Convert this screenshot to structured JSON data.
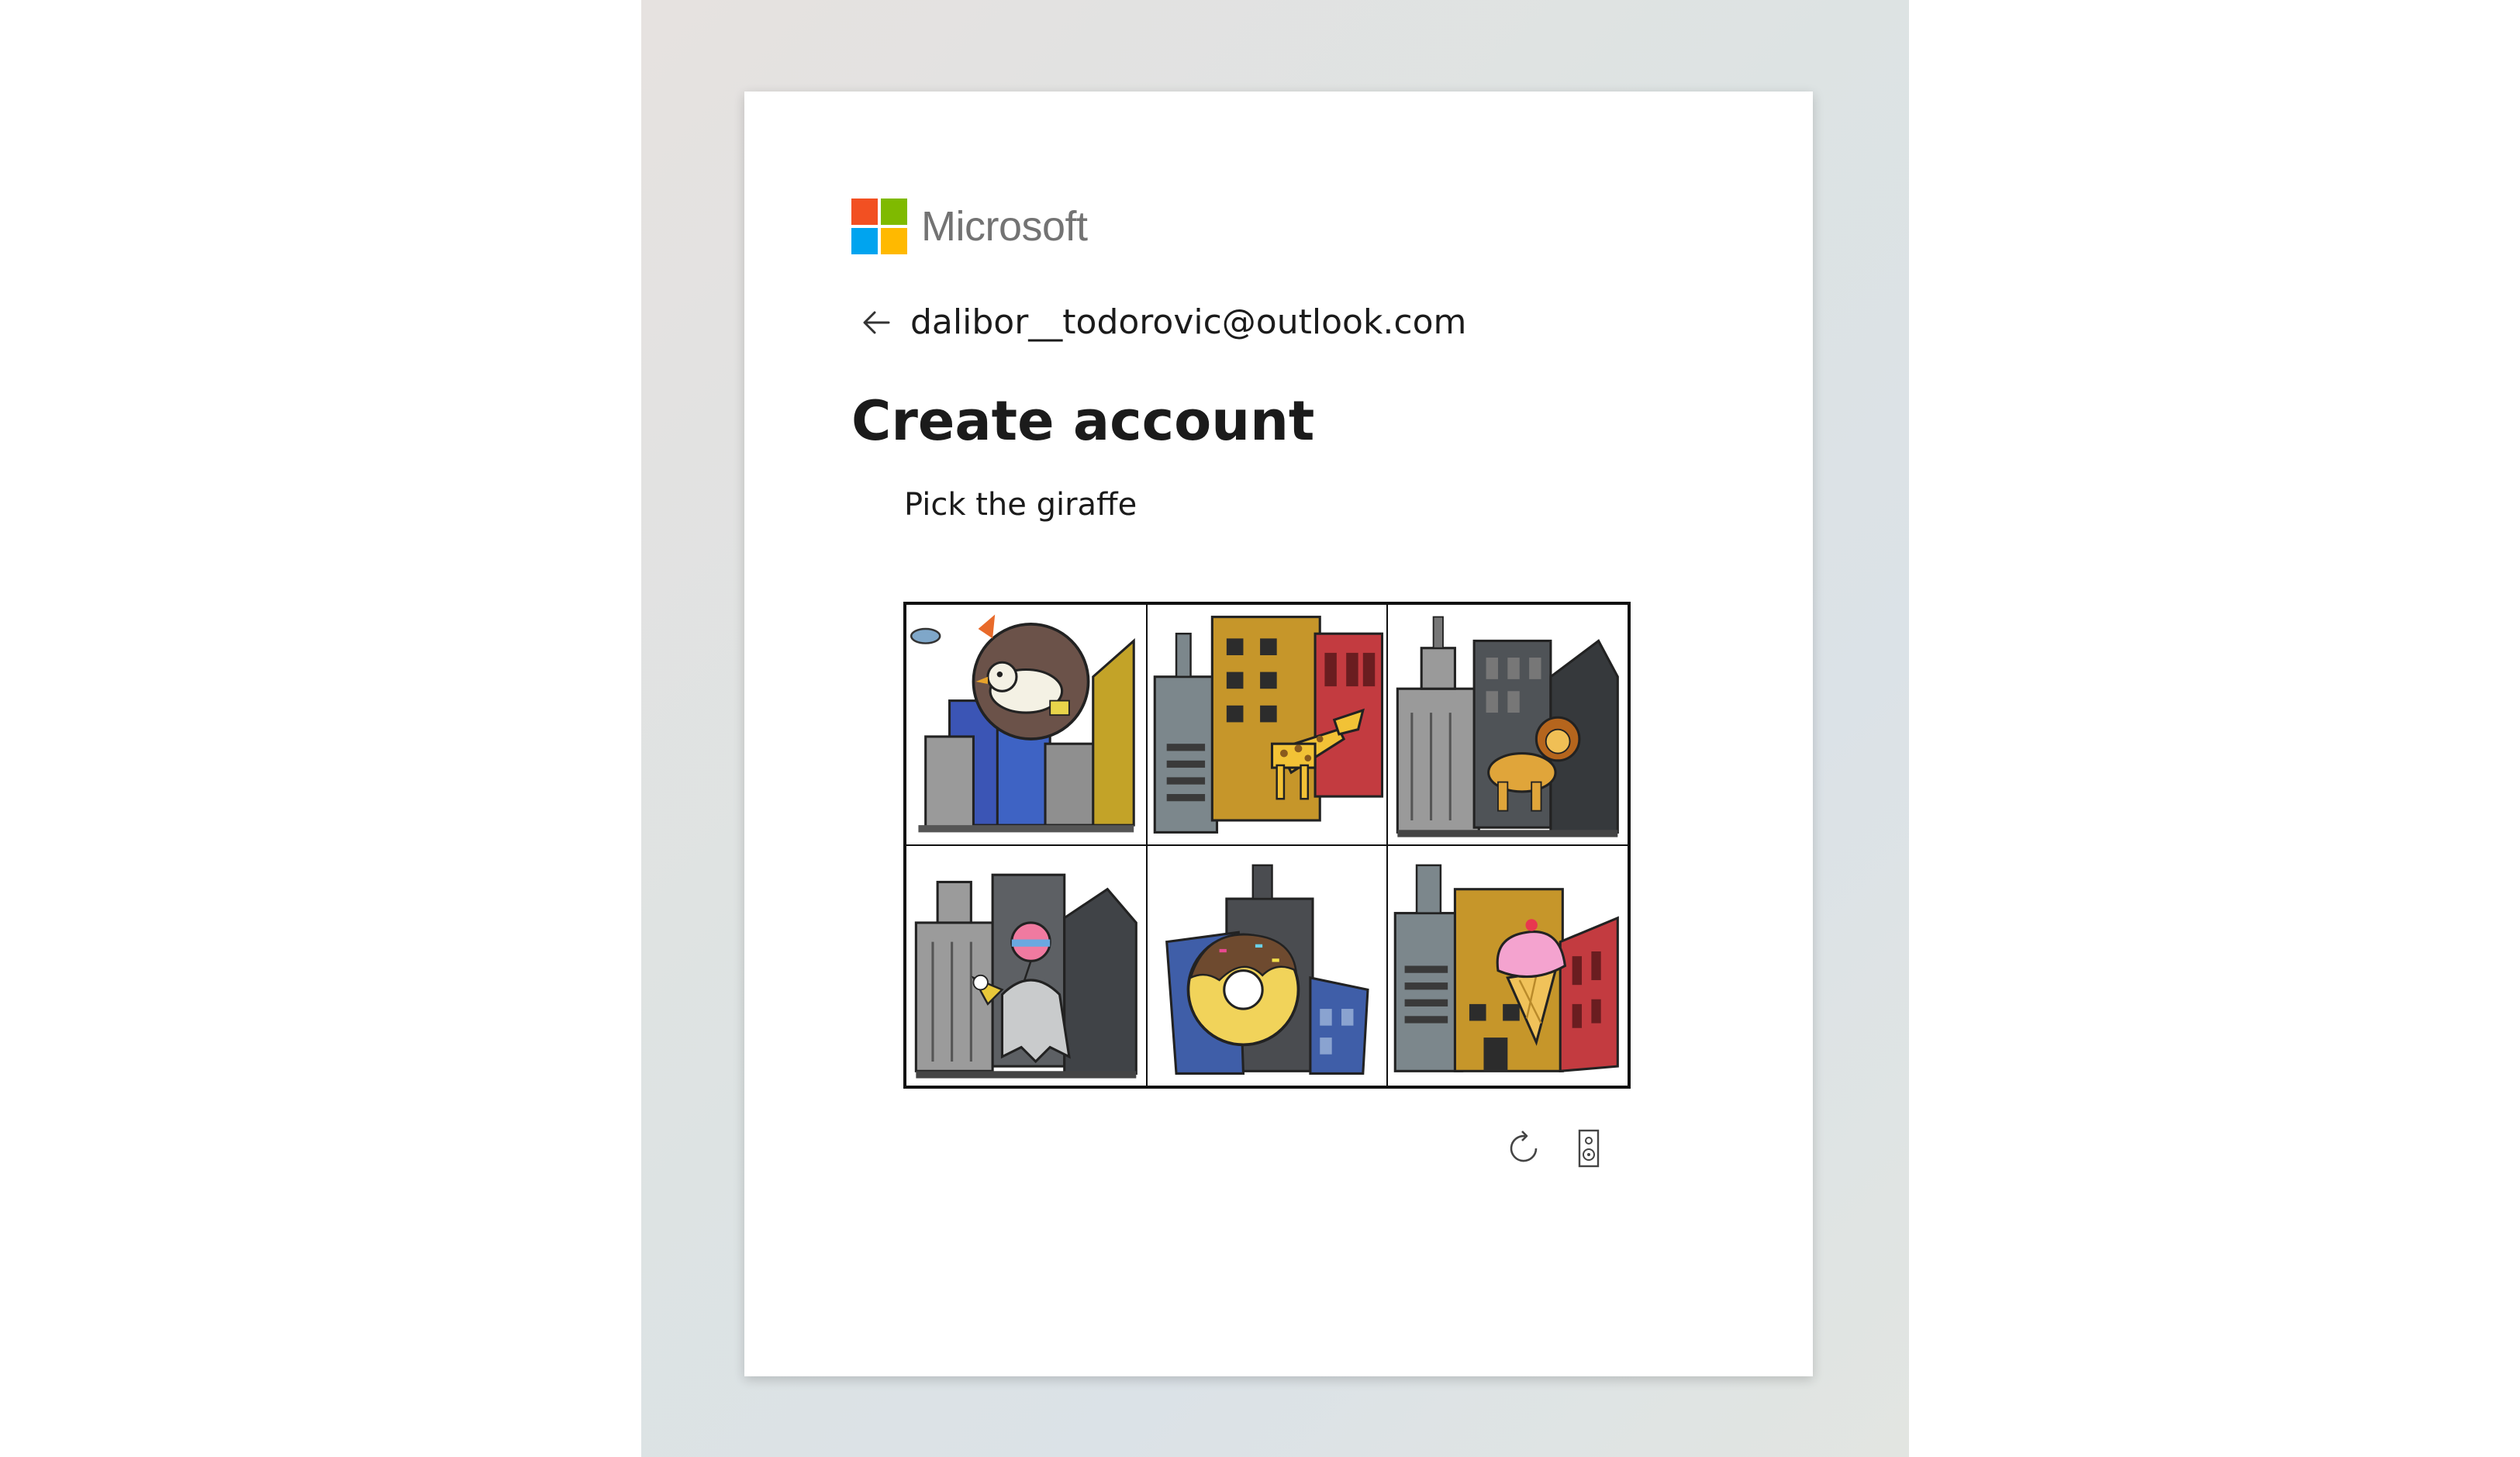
{
  "brand": {
    "name": "Microsoft",
    "logo_colors": [
      "#f25022",
      "#7fba00",
      "#00a4ef",
      "#ffb900"
    ]
  },
  "identity": {
    "email": "dalibor__todorovic@outlook.com",
    "back_icon": "arrow-left-icon"
  },
  "page": {
    "title": "Create account"
  },
  "challenge": {
    "prompt": "Pick the giraffe",
    "tiles": [
      {
        "subject": "bird"
      },
      {
        "subject": "giraffe"
      },
      {
        "subject": "lion"
      },
      {
        "subject": "ghost-with-balloon"
      },
      {
        "subject": "donut"
      },
      {
        "subject": "ice-cream"
      }
    ],
    "controls": {
      "refresh_icon": "refresh-icon",
      "audio_icon": "speaker-icon"
    }
  }
}
